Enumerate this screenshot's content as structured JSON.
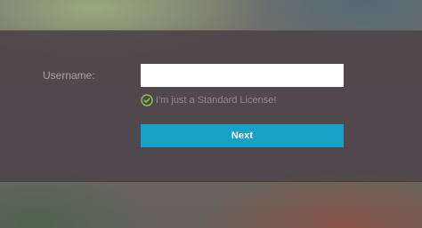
{
  "login": {
    "username_label": "Username:",
    "username_value": "",
    "license_text": "I'm just a Standard License!",
    "license_icon": "check-circle-icon",
    "next_label": "Next"
  },
  "colors": {
    "panel": "#4e464a",
    "accent": "#1aa1c6",
    "success": "#8ec63f"
  }
}
